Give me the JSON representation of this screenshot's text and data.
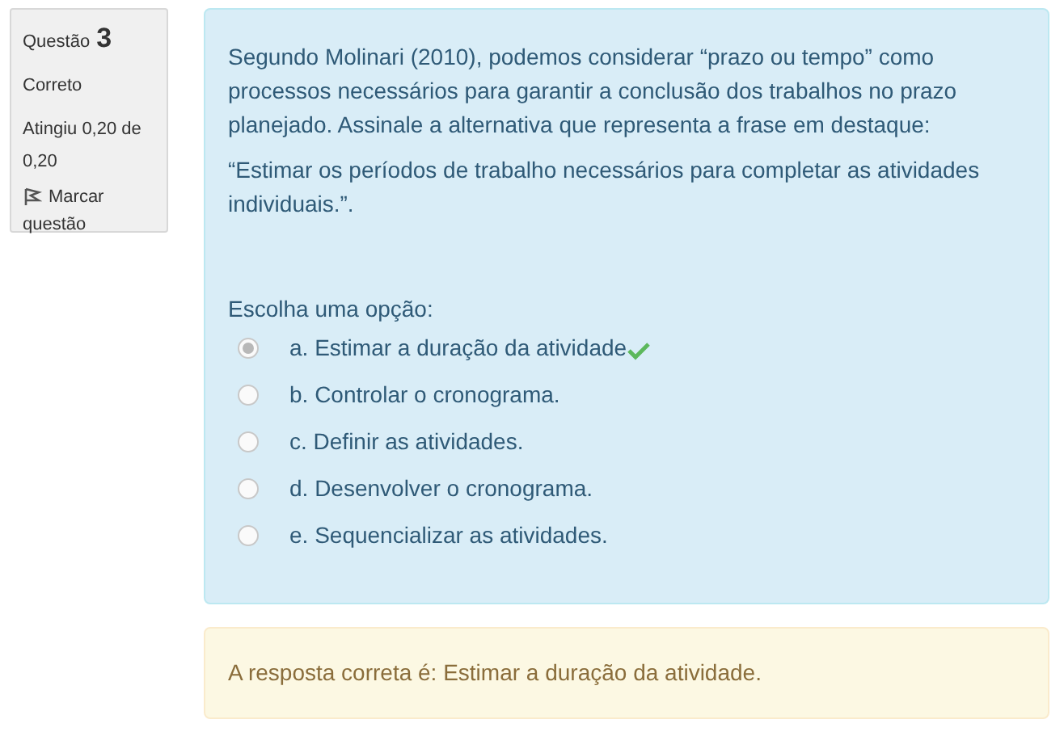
{
  "info": {
    "label": "Questão",
    "number": "3",
    "state": "Correto",
    "grade": "Atingiu 0,20 de 0,20",
    "flag": "Marcar questão"
  },
  "question": {
    "paragraphs": [
      "Segundo Molinari (2010), podemos considerar “prazo ou tempo” como processos necessários para garantir a conclusão dos trabalhos no prazo planejado. Assinale a alternativa que representa a frase em destaque:",
      "“Estimar os períodos de trabalho necessários para completar as atividades individuais.”."
    ],
    "prompt": "Escolha uma opção:",
    "options": [
      {
        "label": "a. Estimar a duração da atividade",
        "selected": true,
        "correct": true
      },
      {
        "label": "b. Controlar o cronograma.",
        "selected": false,
        "correct": false
      },
      {
        "label": "c. Definir as atividades.",
        "selected": false,
        "correct": false
      },
      {
        "label": "d. Desenvolver o cronograma.",
        "selected": false,
        "correct": false
      },
      {
        "label": "e. Sequencializar as atividades.",
        "selected": false,
        "correct": false
      }
    ]
  },
  "feedback": "A resposta correta é: Estimar a duração da atividade."
}
